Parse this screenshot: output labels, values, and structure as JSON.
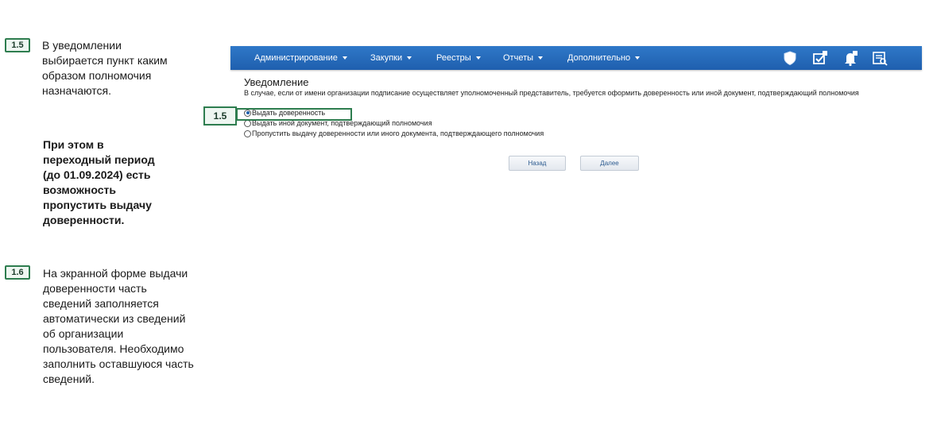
{
  "instructions": [
    {
      "badge": "1.5",
      "text_lines": [
        "В уведомлении",
        "выбирается пункт каким",
        "образом полномочия",
        "назначаются."
      ]
    },
    {
      "text_lines": [
        "При этом в",
        "переходный период",
        "(до 01.09.2024) есть",
        "возможность",
        "пропустить выдачу",
        "доверенности."
      ]
    },
    {
      "badge": "1.6",
      "text_lines": [
        "На экранной форме выдачи",
        "доверенности часть",
        "сведений заполняется",
        "автоматически из сведений",
        "об организации",
        "пользователя. Необходимо",
        "заполнить оставшуюся часть",
        "сведений."
      ]
    }
  ],
  "app": {
    "menu": [
      {
        "label": "Администрирование"
      },
      {
        "label": "Закупки"
      },
      {
        "label": "Реестры"
      },
      {
        "label": "Отчеты"
      },
      {
        "label": "Дополнительно"
      }
    ],
    "toolbar_icons": [
      "shield-icon",
      "tasks-icon",
      "notifications-icon",
      "reports-icon"
    ],
    "title": "Уведомление",
    "description": "В случае, если от имени организации подписание осуществляет уполномоченный представитель, требуется оформить доверенность или иной документ, подтверждающий полномочия",
    "options": [
      {
        "label": "Выдать доверенность",
        "selected": true
      },
      {
        "label": "Выдать иной документ, подтверждающий полномочия",
        "selected": false
      },
      {
        "label": "Пропустить выдачу доверенности или иного документа, подтверждающего полномочия",
        "selected": false
      }
    ],
    "buttons": {
      "back": "Назад",
      "next": "Далее"
    },
    "highlight_badge": "1.5"
  },
  "colors": {
    "accent_green": "#2e7d4f",
    "topbar_blue": "#1f5fae"
  }
}
